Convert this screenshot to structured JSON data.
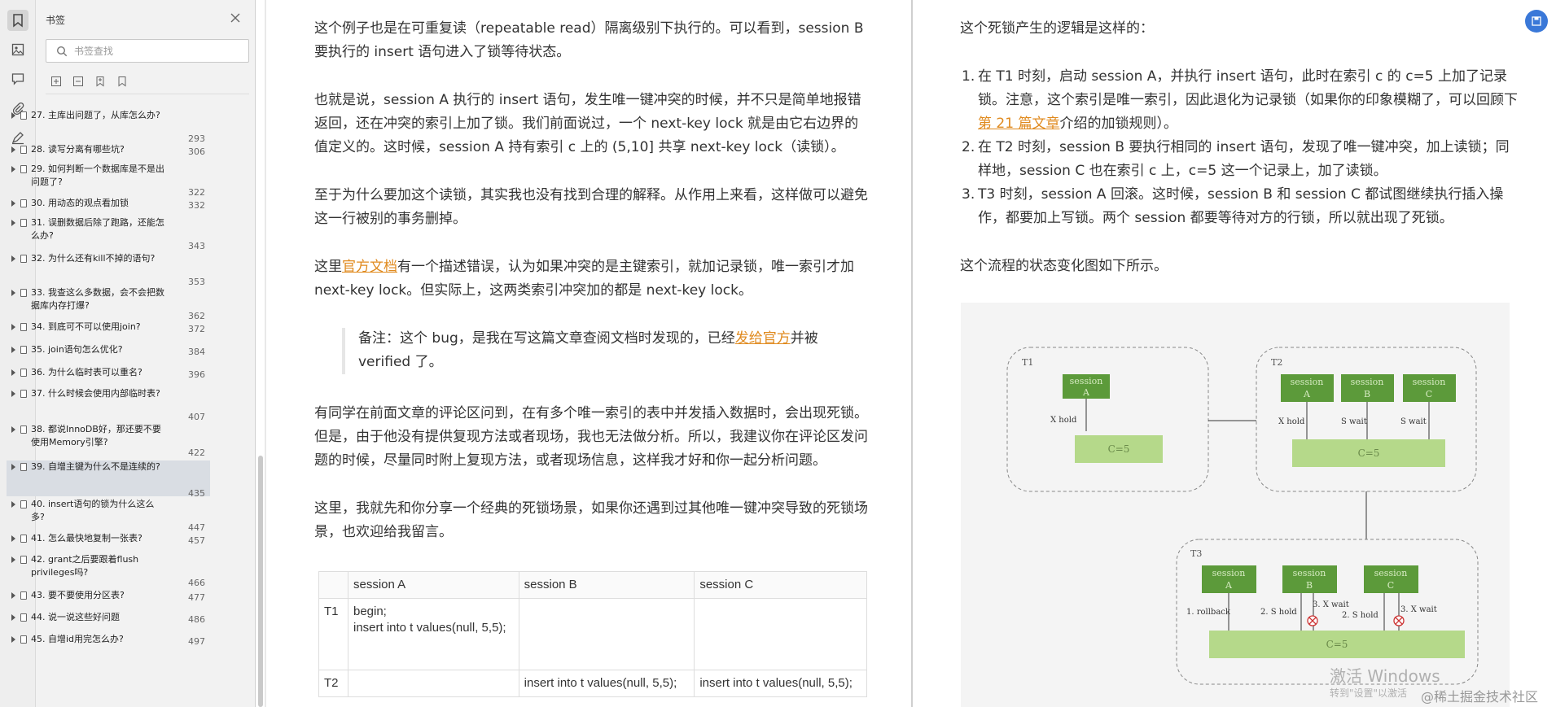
{
  "rail": {
    "items": [
      {
        "name": "bookmark-icon"
      },
      {
        "name": "thumbnail-icon"
      },
      {
        "name": "comment-icon"
      },
      {
        "name": "attachment-icon"
      },
      {
        "name": "signature-icon"
      }
    ]
  },
  "panel": {
    "title": "书签",
    "search_placeholder": "书签查找",
    "bookmarks": [
      {
        "title": "27. 主库出问题了，从库怎么办?",
        "page": "293"
      },
      {
        "title": "28. 读写分离有哪些坑?",
        "page": "306"
      },
      {
        "title": "29. 如何判断一个数据库是不是出问题了?",
        "page": "322"
      },
      {
        "title": "30. 用动态的观点看加锁",
        "page": "332"
      },
      {
        "title": "31. 误删数据后除了跑路，还能怎么办?",
        "page": "343"
      },
      {
        "title": "32. 为什么还有kill不掉的语句?",
        "page": "353"
      },
      {
        "title": "33. 我查这么多数据，会不会把数据库内存打爆?",
        "page": "362"
      },
      {
        "title": "34. 到底可不可以使用join?",
        "page": "372"
      },
      {
        "title": "35. join语句怎么优化?",
        "page": "384"
      },
      {
        "title": "36. 为什么临时表可以重名?",
        "page": "396"
      },
      {
        "title": "37. 什么时候会使用内部临时表?",
        "page": "407"
      },
      {
        "title": "38. 都说InnoDB好，那还要不要使用Memory引擎?",
        "page": "422"
      },
      {
        "title": "39. 自增主键为什么不是连续的?",
        "page": "435",
        "selected": true
      },
      {
        "title": "40. insert语句的锁为什么这么多?",
        "page": "447"
      },
      {
        "title": "41. 怎么最快地复制一张表?",
        "page": "457"
      },
      {
        "title": "42. grant之后要跟着flush privileges吗?",
        "page": "466"
      },
      {
        "title": "43. 要不要使用分区表?",
        "page": "477"
      },
      {
        "title": "44. 说一说这些好问题",
        "page": "486"
      },
      {
        "title": "45. 自增id用完怎么办?",
        "page": "497"
      }
    ]
  },
  "left_page": {
    "p1": "这个例子也是在可重复读（repeatable read）隔离级别下执行的。可以看到，session B要执行的 insert 语句进入了锁等待状态。",
    "p2": "也就是说，session A 执行的 insert 语句，发生唯一键冲突的时候，并不只是简单地报错返回，还在冲突的索引上加了锁。我们前面说过，一个 next-key lock 就是由它右边界的值定义的。这时候，session A 持有索引 c 上的 (5,10] 共享 next-key lock（读锁）。",
    "p3": "至于为什么要加这个读锁，其实我也没有找到合理的解释。从作用上来看，这样做可以避免这一行被别的事务删掉。",
    "p4_pre": "这里",
    "p4_link": "官方文档",
    "p4_post": "有一个描述错误，认为如果冲突的是主键索引，就加记录锁，唯一索引才加 next-key lock。但实际上，这两类索引冲突加的都是 next-key lock。",
    "note_pre": "备注：这个 bug，是我在写这篇文章查阅文档时发现的，已经",
    "note_link": "发给官方",
    "note_post": "并被verified 了。",
    "p5": "有同学在前面文章的评论区问到，在有多个唯一索引的表中并发插入数据时，会出现死锁。但是，由于他没有提供复现方法或者现场，我也无法做分析。所以，我建议你在评论区发问题的时候，尽量同时附上复现方法，或者现场信息，这样我才好和你一起分析问题。",
    "p6": "这里，我就先和你分享一个经典的死锁场景，如果你还遇到过其他唯一键冲突导致的死锁场景，也欢迎给我留言。",
    "table": {
      "headers": [
        "",
        "session A",
        "session B",
        "session C"
      ],
      "rows": [
        [
          "T1",
          "begin;\ninsert into t values(null, 5,5);",
          "",
          ""
        ],
        [
          "T2",
          "",
          "insert into t values(null, 5,5);",
          "insert into t values(null, 5,5);"
        ]
      ]
    }
  },
  "right_page": {
    "intro": "这个死锁产生的逻辑是这样的：",
    "steps": [
      {
        "num": "1.",
        "pre": "在 T1 时刻，启动 session A，并执行 insert 语句，此时在索引 c 的 c=5 上加了记录锁。注意，这个索引是唯一索引，因此退化为记录锁（如果你的印象模糊了，可以回顾下",
        "link": "第 21 篇文章",
        "post": "介绍的加锁规则）。"
      },
      {
        "num": "2.",
        "pre": "在 T2 时刻，session B 要执行相同的 insert 语句，发现了唯一键冲突，加上读锁；同样地，session C 也在索引 c 上，c=5 这一个记录上，加了读锁。",
        "link": "",
        "post": ""
      },
      {
        "num": "3.",
        "pre": "T3 时刻，session A 回滚。这时候，session B 和 session C 都试图继续执行插入操作，都要加上写锁。两个 session 都要等待对方的行锁，所以就出现了死锁。",
        "link": "",
        "post": ""
      }
    ],
    "flow_text": "这个流程的状态变化图如下所示。",
    "diagram": {
      "t1": {
        "label": "T1",
        "session": [
          "session",
          "A"
        ],
        "edge": "X hold",
        "record": "C=5"
      },
      "t2": {
        "label": "T2",
        "sessions": [
          [
            "session",
            "A"
          ],
          [
            "session",
            "B"
          ],
          [
            "session",
            "C"
          ]
        ],
        "edges": [
          "X hold",
          "S wait",
          "S wait"
        ],
        "record": "C=5"
      },
      "t3": {
        "label": "T3",
        "sessions": [
          [
            "session",
            "A"
          ],
          [
            "session",
            "B"
          ],
          [
            "session",
            "C"
          ]
        ],
        "edges": [
          "1. rollback",
          "2. S hold",
          "3. X wait",
          "2. S hold",
          "3. X wait"
        ],
        "record": "C=5"
      },
      "colors": {
        "box": "#5c9a3a",
        "record": "#b5d98a",
        "dash": "#888888"
      }
    }
  },
  "overlay": {
    "watermark": "激活 Windows",
    "watermark_sub": "转到\"设置\"以激活",
    "credit": "@稀土掘金技术社区"
  }
}
